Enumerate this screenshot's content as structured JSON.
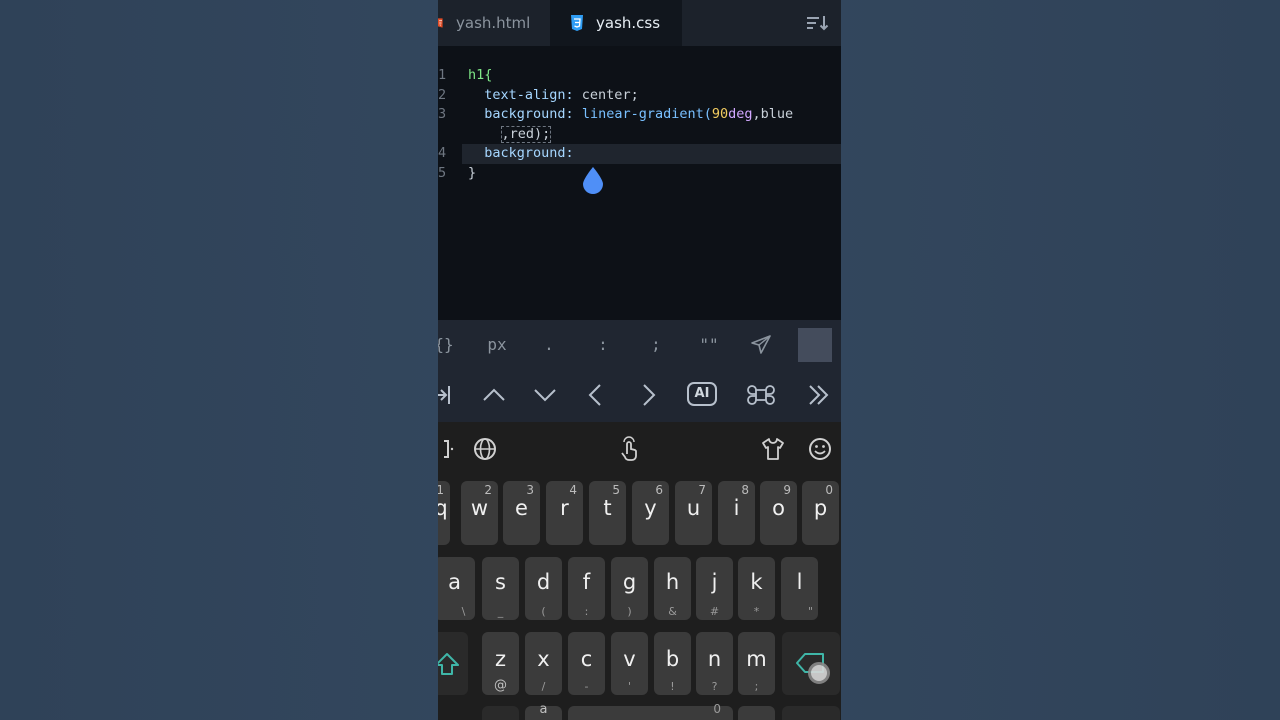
{
  "tabs": [
    {
      "label": "yash.html",
      "icon": "html5-icon",
      "active": false
    },
    {
      "label": "yash.css",
      "icon": "css3-icon",
      "active": true
    }
  ],
  "editor": {
    "line_numbers": [
      "1",
      "2",
      "3",
      "",
      "4",
      "5"
    ],
    "lines": [
      {
        "selector": "h1{"
      },
      {
        "prop": "text-align:",
        "value": " center;"
      },
      {
        "prop": "background:",
        "func": "linear-gradient(",
        "num": "90",
        "unit": "deg",
        "rest": ",blue"
      },
      {
        "wrap": ",red);"
      },
      {
        "prop": "background:"
      },
      {
        "close": "}"
      }
    ]
  },
  "symbol_bar": [
    "{}",
    "px",
    ".",
    ":",
    ";",
    "\"\""
  ],
  "nav_bar": {
    "ai_label": "AI"
  },
  "keyboard": {
    "row1": [
      {
        "k": "q",
        "h": "1"
      },
      {
        "k": "w",
        "h": "2"
      },
      {
        "k": "e",
        "h": "3"
      },
      {
        "k": "r",
        "h": "4"
      },
      {
        "k": "t",
        "h": "5"
      },
      {
        "k": "y",
        "h": "6"
      },
      {
        "k": "u",
        "h": "7"
      },
      {
        "k": "i",
        "h": "8"
      },
      {
        "k": "o",
        "h": "9"
      },
      {
        "k": "p",
        "h": "0"
      }
    ],
    "row2": [
      {
        "k": "a",
        "s": "\\"
      },
      {
        "k": "s",
        "s": "_"
      },
      {
        "k": "d",
        "s": "("
      },
      {
        "k": "f",
        "s": ":"
      },
      {
        "k": "g",
        "s": ")"
      },
      {
        "k": "h",
        "s": "&"
      },
      {
        "k": "j",
        "s": "#"
      },
      {
        "k": "k",
        "s": "*"
      },
      {
        "k": "l",
        "s": "\""
      }
    ],
    "row3": [
      {
        "k": "z",
        "s": "@"
      },
      {
        "k": "x",
        "s": "/"
      },
      {
        "k": "c",
        "s": "-"
      },
      {
        "k": "v",
        "s": "'"
      },
      {
        "k": "b",
        "s": "!"
      },
      {
        "k": "n",
        "s": "?"
      },
      {
        "k": "m",
        "s": ";"
      }
    ],
    "row4_hints": [
      "a",
      "0"
    ]
  },
  "colors": {
    "accent_blue": "#4f8ff7",
    "shift_teal": "#3fb6a8"
  }
}
